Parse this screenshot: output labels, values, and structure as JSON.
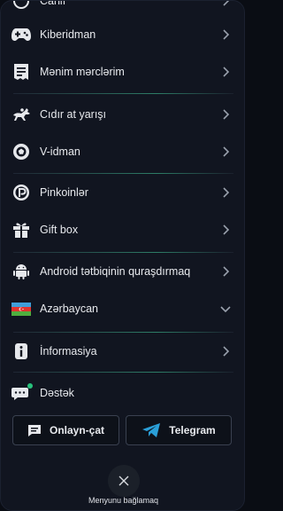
{
  "menu": {
    "items": [
      {
        "label": "Canlı",
        "icon": "live-icon"
      },
      {
        "label": "Kiberidman",
        "icon": "gamepad-icon"
      },
      {
        "label": "Mənim mərclərim",
        "icon": "receipt-icon"
      },
      {
        "label": "Cıdır at yarışı",
        "icon": "horse-racing-icon"
      },
      {
        "label": "V-idman",
        "icon": "virtual-sport-icon"
      },
      {
        "label": "Pinkoinlər",
        "icon": "pincoin-icon"
      },
      {
        "label": "Gift box",
        "icon": "gift-icon"
      },
      {
        "label": "Android tətbiqinin quraşdırmaq",
        "icon": "android-icon"
      },
      {
        "label": "Azərbaycan",
        "icon": "azerbaijan-flag-icon"
      },
      {
        "label": "İnformasiya",
        "icon": "info-icon"
      },
      {
        "label": "Dəstək",
        "icon": "support-chat-icon"
      }
    ]
  },
  "actions": {
    "chat_label": "Onlayn-çat",
    "telegram_label": "Telegram",
    "close_label": "Menyunu bağlamaq"
  },
  "colors": {
    "background": "#111520",
    "accent_green": "#28c27c",
    "telegram_blue": "#2a9fd8"
  }
}
